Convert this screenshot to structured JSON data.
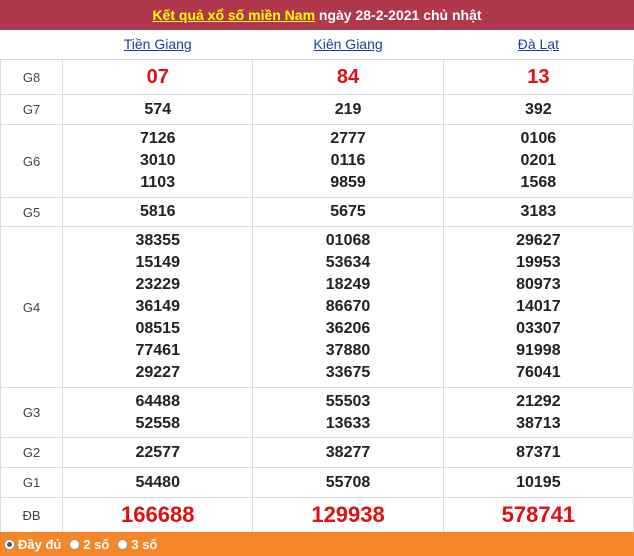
{
  "header": {
    "link_text": "Kết quả xổ số miền Nam",
    "date_text": " ngày 28-2-2021 chủ nhật"
  },
  "provinces": [
    "Tiền Giang",
    "Kiên Giang",
    "Đà Lạt"
  ],
  "rows": [
    {
      "label": "G8",
      "values": [
        [
          "07"
        ],
        [
          "84"
        ],
        [
          "13"
        ]
      ]
    },
    {
      "label": "G7",
      "values": [
        [
          "574"
        ],
        [
          "219"
        ],
        [
          "392"
        ]
      ]
    },
    {
      "label": "G6",
      "values": [
        [
          "7126",
          "3010",
          "1103"
        ],
        [
          "2777",
          "0116",
          "9859"
        ],
        [
          "0106",
          "0201",
          "1568"
        ]
      ]
    },
    {
      "label": "G5",
      "values": [
        [
          "5816"
        ],
        [
          "5675"
        ],
        [
          "3183"
        ]
      ]
    },
    {
      "label": "G4",
      "values": [
        [
          "38355",
          "15149",
          "23229",
          "36149",
          "08515",
          "77461",
          "29227"
        ],
        [
          "01068",
          "53634",
          "18249",
          "86670",
          "36206",
          "37880",
          "33675"
        ],
        [
          "29627",
          "19953",
          "80973",
          "14017",
          "03307",
          "91998",
          "76041"
        ]
      ]
    },
    {
      "label": "G3",
      "values": [
        [
          "64488",
          "52558"
        ],
        [
          "55503",
          "13633"
        ],
        [
          "21292",
          "38713"
        ]
      ]
    },
    {
      "label": "G2",
      "values": [
        [
          "22577"
        ],
        [
          "38277"
        ],
        [
          "87371"
        ]
      ]
    },
    {
      "label": "G1",
      "values": [
        [
          "54480"
        ],
        [
          "55708"
        ],
        [
          "10195"
        ]
      ]
    },
    {
      "label": "ĐB",
      "values": [
        [
          "166688"
        ],
        [
          "129938"
        ],
        [
          "578741"
        ]
      ]
    }
  ],
  "footer": {
    "options": [
      {
        "label": "Đầy đủ",
        "selected": true
      },
      {
        "label": "2 số",
        "selected": false
      },
      {
        "label": "3 số",
        "selected": false
      }
    ]
  },
  "colors": {
    "header_bg": "#b0384d",
    "highlight": "#d11111",
    "footer_bg": "#f5862a"
  }
}
